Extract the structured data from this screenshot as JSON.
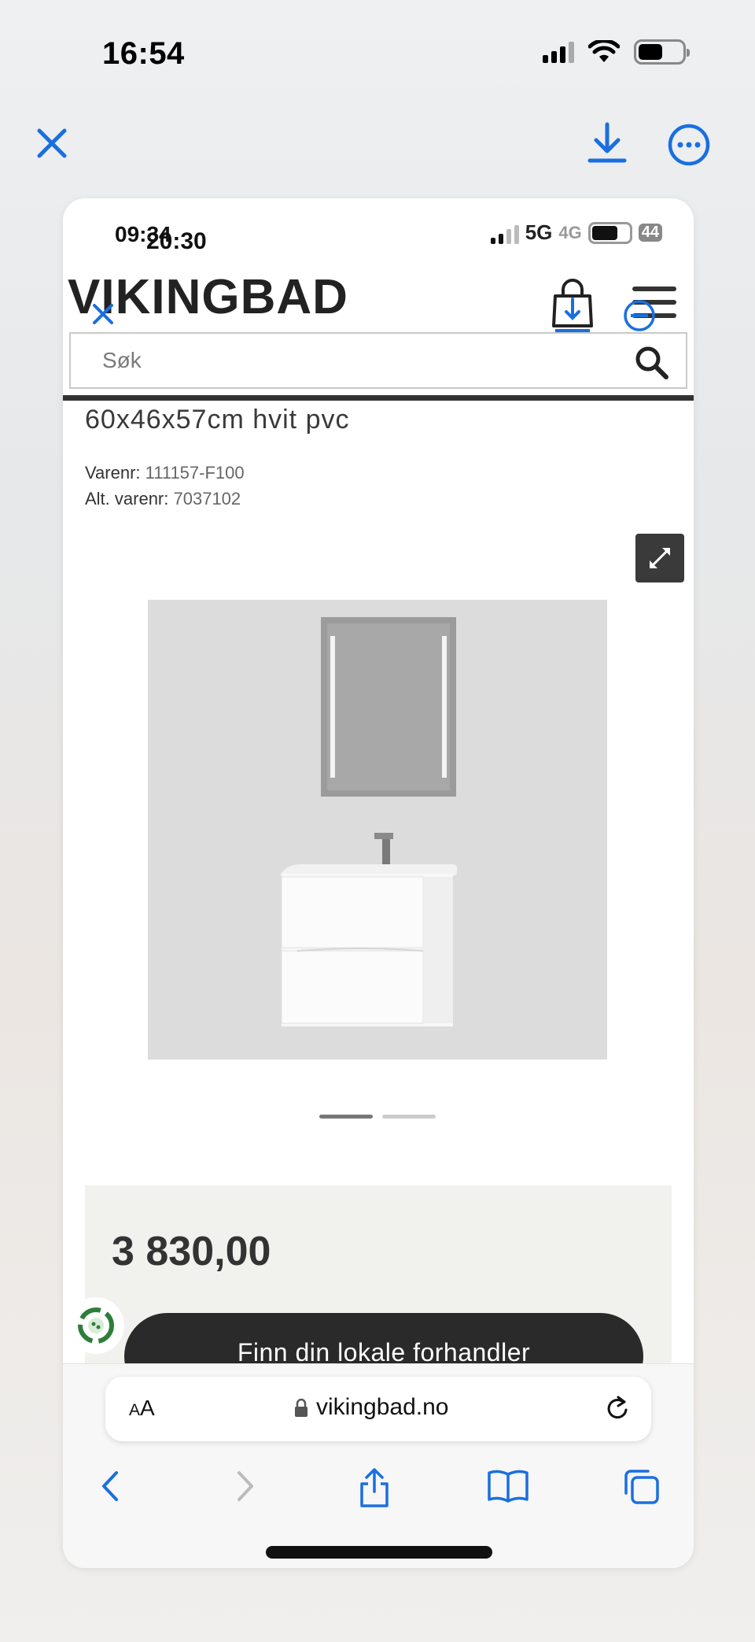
{
  "device": {
    "time": "16:54"
  },
  "viewer": {
    "close_icon": "close-icon",
    "download_icon": "download-icon",
    "more_icon": "more-icon"
  },
  "screenshot": {
    "status": {
      "time_a": "09:34",
      "time_b": "20:30",
      "network_a": "5G",
      "network_b": "4G",
      "battery": "44"
    },
    "site": {
      "logo": "VIKINGBAD",
      "search_placeholder": "Søk",
      "product_title": "60x46x57cm hvit pvc",
      "sku_label": "Varenr:",
      "sku_value": "111157-F100",
      "alt_sku_label": "Alt. varenr:",
      "alt_sku_value": "7037102",
      "price": "3 830,00",
      "dealer_button": "Finn din lokale forhandler",
      "image_slides_total": 2,
      "image_slide_active": 1
    },
    "browser": {
      "text_size_label_small": "A",
      "text_size_label_large": "A",
      "url": "vikingbad.no"
    }
  },
  "colors": {
    "accent_blue": "#1a6fe0",
    "dark_button": "#2a2a2a",
    "price_panel_bg": "#f1f1ee"
  }
}
